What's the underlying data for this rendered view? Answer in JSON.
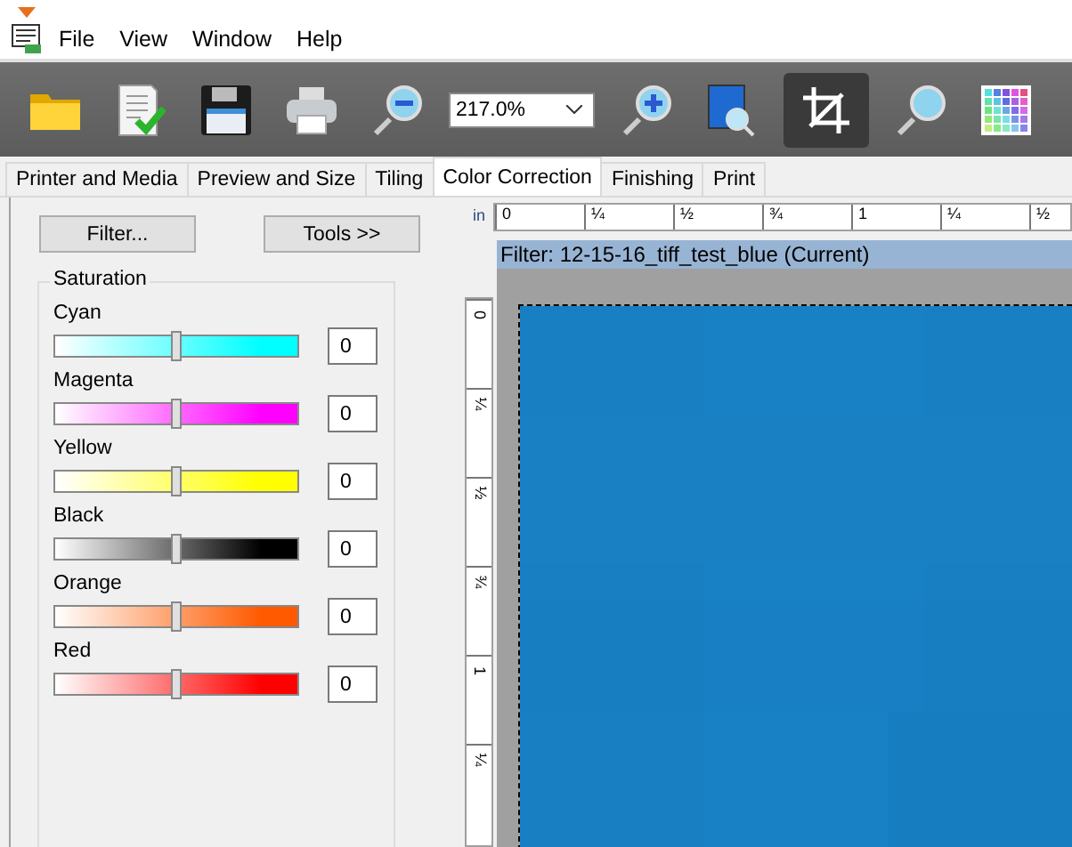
{
  "menu": [
    "File",
    "View",
    "Window",
    "Help"
  ],
  "toolbar": {
    "left_tools": [
      {
        "kind": "open",
        "selected": false
      },
      {
        "kind": "document",
        "selected": false
      },
      {
        "kind": "save",
        "selected": false
      },
      {
        "kind": "print",
        "selected": false
      },
      {
        "kind": "zoom-out",
        "selected": false
      }
    ],
    "zoom": "217.0%",
    "right_tools": [
      {
        "kind": "zoom-in",
        "selected": false
      },
      {
        "kind": "fit",
        "selected": false
      },
      {
        "kind": "crop",
        "selected": true
      },
      {
        "kind": "zoom",
        "selected": false
      },
      {
        "kind": "palette",
        "selected": false
      }
    ]
  },
  "tabs": [
    {
      "label": "Printer and Media",
      "selected": false
    },
    {
      "label": "Preview and Size",
      "selected": false
    },
    {
      "label": "Tiling",
      "selected": false
    },
    {
      "label": "Color Correction",
      "selected": true
    },
    {
      "label": "Finishing",
      "selected": false
    },
    {
      "label": "Print",
      "selected": false
    }
  ],
  "buttons": [
    "Filter...",
    "Tools >>"
  ],
  "saturation": {
    "title": "Saturation",
    "sliders": [
      {
        "name": "Cyan",
        "color": "#00ffff",
        "level": 0.5,
        "value": "0"
      },
      {
        "name": "Magenta",
        "color": "#ff00ff",
        "level": 0.5,
        "value": "0"
      },
      {
        "name": "Yellow",
        "color": "#ffff00",
        "level": 0.5,
        "value": "0"
      },
      {
        "name": "Black",
        "color": "#000000",
        "level": 0.5,
        "value": "0"
      },
      {
        "name": "Orange",
        "color": "#ff5a00",
        "level": 0.5,
        "value": "0"
      },
      {
        "name": "Red",
        "color": "#ff0000",
        "level": 0.5,
        "value": "0"
      }
    ]
  },
  "preview": {
    "unit": "in",
    "h_ticks": [
      "0",
      "¼",
      "½",
      "¾",
      "1",
      "¼",
      "½"
    ],
    "v_ticks": [
      "0",
      "¼",
      "½",
      "¾",
      "1",
      "¼"
    ],
    "title": "Filter: 12-15-16_tiff_test_blue (Current)"
  }
}
